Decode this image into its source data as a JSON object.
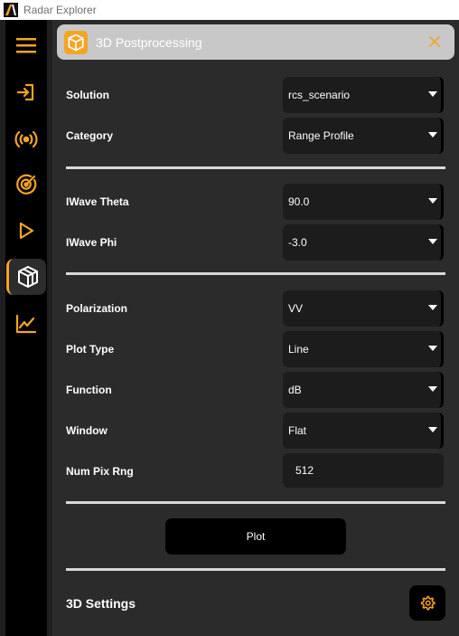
{
  "window": {
    "title": "Radar Explorer"
  },
  "colors": {
    "accent": "#f5a524",
    "panel_bg": "#2b2b2b",
    "control_bg": "#1c1c1c"
  },
  "sidebar": {
    "items": [
      {
        "name": "menu",
        "icon": "hamburger-menu-icon"
      },
      {
        "name": "import",
        "icon": "import-arrow-icon"
      },
      {
        "name": "antenna",
        "icon": "antenna-broadcast-icon"
      },
      {
        "name": "radar",
        "icon": "radar-target-icon"
      },
      {
        "name": "run",
        "icon": "play-icon"
      },
      {
        "name": "postprocessing-3d",
        "icon": "cube-icon",
        "active": true
      },
      {
        "name": "plots",
        "icon": "line-chart-icon"
      }
    ]
  },
  "panel": {
    "title": "3D Postprocessing",
    "header_icon": "cube-icon",
    "close_icon": "close-icon"
  },
  "form": {
    "solution": {
      "label": "Solution",
      "value": "rcs_scenario"
    },
    "category": {
      "label": "Category",
      "value": "Range Profile"
    },
    "iwave_theta": {
      "label": "IWave Theta",
      "value": "90.0"
    },
    "iwave_phi": {
      "label": "IWave Phi",
      "value": "-3.0"
    },
    "polarization": {
      "label": "Polarization",
      "value": "VV"
    },
    "plot_type": {
      "label": "Plot Type",
      "value": "Line"
    },
    "function": {
      "label": "Function",
      "value": "dB"
    },
    "window": {
      "label": "Window",
      "value": "Flat"
    },
    "num_pix_rng": {
      "label": "Num Pix Rng",
      "value": "512"
    }
  },
  "plot_button": {
    "label": "Plot"
  },
  "settings_section": {
    "label": "3D Settings",
    "icon": "gear-icon"
  }
}
